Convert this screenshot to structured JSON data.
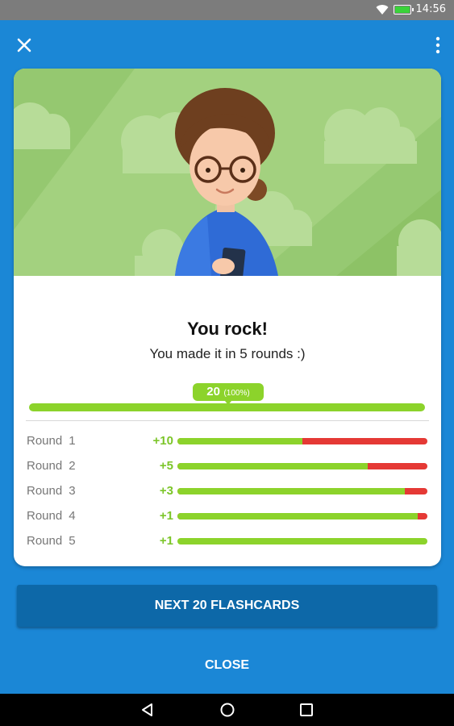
{
  "status_bar": {
    "time": "14:56",
    "icons": [
      "wifi-icon",
      "battery-charging-icon"
    ]
  },
  "app_bar": {
    "left_icon": "close-icon",
    "right_icon": "more-vert-icon"
  },
  "result": {
    "title": "You rock!",
    "subtitle": "You made it in 5 rounds :)",
    "total": {
      "count": "20",
      "percent": "(100%)",
      "progress": 1.0
    }
  },
  "rounds": [
    {
      "label": "Round",
      "number": "1",
      "delta": "+10",
      "correct_fraction": 0.5
    },
    {
      "label": "Round",
      "number": "2",
      "delta": "+5",
      "correct_fraction": 0.76
    },
    {
      "label": "Round",
      "number": "3",
      "delta": "+3",
      "correct_fraction": 0.91
    },
    {
      "label": "Round",
      "number": "4",
      "delta": "+1",
      "correct_fraction": 0.96
    },
    {
      "label": "Round",
      "number": "5",
      "delta": "+1",
      "correct_fraction": 1.0
    }
  ],
  "actions": {
    "primary": "NEXT 20 FLASHCARDS",
    "secondary": "CLOSE"
  },
  "nav_bar": {
    "icons": [
      "back-icon",
      "home-icon",
      "recents-icon"
    ]
  },
  "colors": {
    "background": "#1b87d6",
    "primary_button": "#0d68a8",
    "accent_green": "#8cd32b",
    "error_red": "#e53935"
  }
}
